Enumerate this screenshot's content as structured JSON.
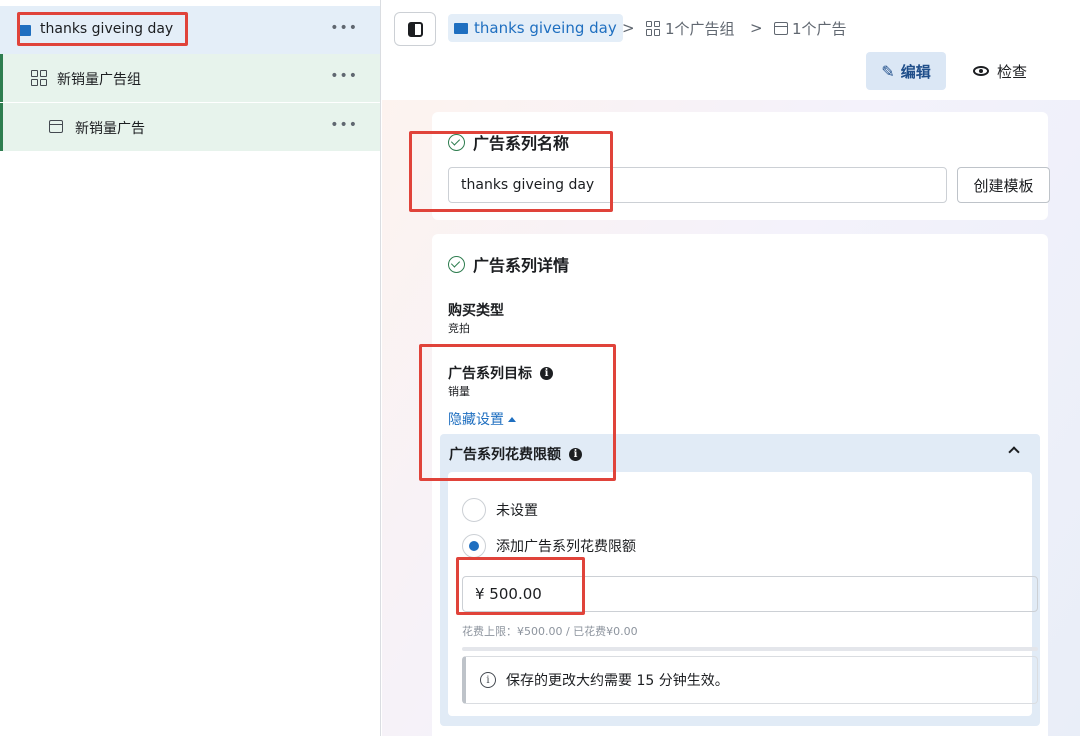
{
  "sidebar": {
    "items": [
      {
        "label": "thanks giveing day",
        "more": "•••"
      },
      {
        "label": "新销量广告组",
        "more": "•••"
      },
      {
        "label": "新销量广告",
        "more": "•••"
      }
    ]
  },
  "header": {
    "breadcrumb": {
      "campaign": "thanks giveing day",
      "separator": ">",
      "adset": "1个广告组",
      "ad": "1个广告"
    },
    "edit_label": "编辑",
    "review_label": "检查"
  },
  "name_section": {
    "title": "广告系列名称",
    "value": "thanks giveing day",
    "template_button": "创建模板"
  },
  "detail_section": {
    "title": "广告系列详情",
    "buy_type_label": "购买类型",
    "buy_type_value": "竞拍",
    "objective_label": "广告系列目标",
    "objective_value": "销量",
    "hide_settings": "隐藏设置",
    "limit": {
      "title": "广告系列花费限额",
      "options": [
        "未设置",
        "添加广告系列花费限额"
      ],
      "selected_index": 1,
      "amount": "¥ 500.00",
      "spend_note": "花费上限：¥500.00 / 已花费¥0.00",
      "spent_fraction": 0,
      "notice": "保存的更改大约需要 15 分钟生效。"
    }
  },
  "colors": {
    "accent": "#1f6fc0",
    "success": "#2e7d4f",
    "highlight": "#e0433a"
  }
}
